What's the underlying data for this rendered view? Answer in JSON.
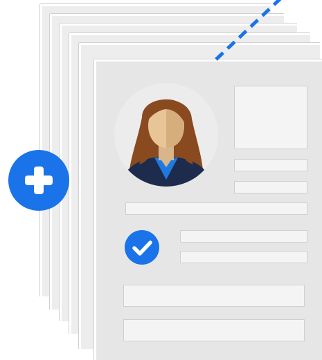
{
  "illustration": {
    "sheet_count": 6,
    "accent_color": "#1a73e8",
    "sheet_color": "#e6e6e6",
    "block_color": "#f4f4f4",
    "icons": [
      "plus-icon",
      "check-icon",
      "avatar-icon"
    ]
  }
}
